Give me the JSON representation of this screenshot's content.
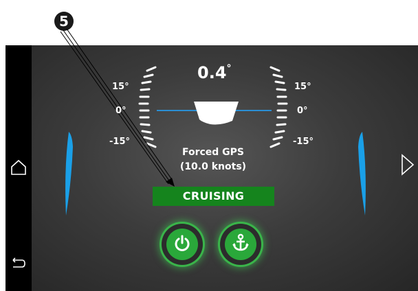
{
  "callout": {
    "number": "5"
  },
  "trim": {
    "angle_value": "0.4",
    "angle_unit": "°",
    "scale_left": {
      "top": "15°",
      "mid": "0°",
      "bottom": "-15°"
    },
    "scale_right": {
      "top": "15°",
      "mid": "0°",
      "bottom": "-15°"
    }
  },
  "speed": {
    "source": "Forced GPS",
    "value": "(10.0 knots)"
  },
  "mode": {
    "label": "CRUISING"
  },
  "controls": {
    "power_icon": "power-icon",
    "anchor_icon": "anchor-icon"
  },
  "nav": {
    "home_icon": "home-icon",
    "back_icon": "back-icon",
    "next_icon": "next-arrow-icon"
  },
  "colors": {
    "background": "#3a3a3a",
    "tab_blue": "#1aa0e8",
    "mode_green": "#15841d",
    "button_glow": "#3ab44a",
    "horizon_line": "#2b8fd4"
  }
}
